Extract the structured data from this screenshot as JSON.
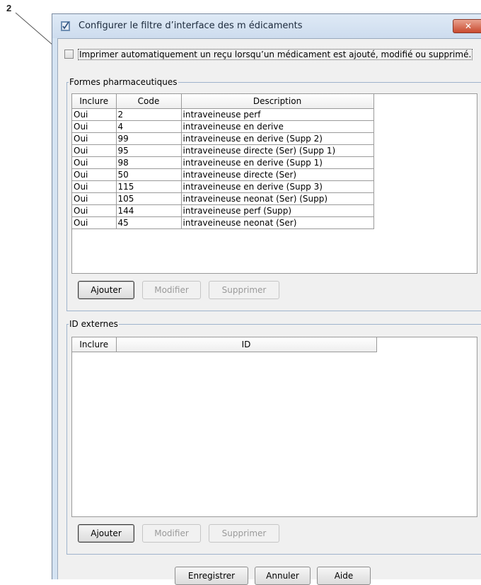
{
  "annotation": {
    "number": "2"
  },
  "dialog": {
    "title": "Configurer le filtre d’interface des m édicaments",
    "close_symbol": "✕",
    "print_receipt_label": "Imprimer automatiquement un reçu lorsqu’un médicament est ajouté, modifié ou supprimé.",
    "print_receipt_checked": false
  },
  "forms_group": {
    "legend": "Formes pharmaceutiques",
    "columns": [
      "Inclure",
      "Code",
      "Description"
    ],
    "rows": [
      [
        "Oui",
        "2",
        "intraveineuse perf"
      ],
      [
        "Oui",
        "4",
        "intraveineuse en derive"
      ],
      [
        "Oui",
        "99",
        "intraveineuse en derive (Supp 2)"
      ],
      [
        "Oui",
        "95",
        "intraveineuse directe (Ser) (Supp 1)"
      ],
      [
        "Oui",
        "98",
        "intraveineuse en derive (Supp 1)"
      ],
      [
        "Oui",
        "50",
        "intraveineuse directe (Ser)"
      ],
      [
        "Oui",
        "115",
        "intraveineuse en derive (Supp 3)"
      ],
      [
        "Oui",
        "105",
        "intraveineuse neonat (Ser) (Supp)"
      ],
      [
        "Oui",
        "144",
        "intraveineuse perf (Supp)"
      ],
      [
        "Oui",
        "45",
        "intraveineuse neonat (Ser)"
      ]
    ],
    "buttons": {
      "add": "Ajouter",
      "edit": "Modifier",
      "delete": "Supprimer"
    }
  },
  "ext_group": {
    "legend": "ID externes",
    "columns": [
      "Inclure",
      "ID"
    ],
    "rows": [],
    "buttons": {
      "add": "Ajouter",
      "edit": "Modifier",
      "delete": "Supprimer"
    }
  },
  "footer": {
    "save": "Enregistrer",
    "cancel": "Annuler",
    "help": "Aide"
  },
  "colors": {
    "close_button": "#c94a2f",
    "callout_arrow": "#4a9a2a"
  }
}
